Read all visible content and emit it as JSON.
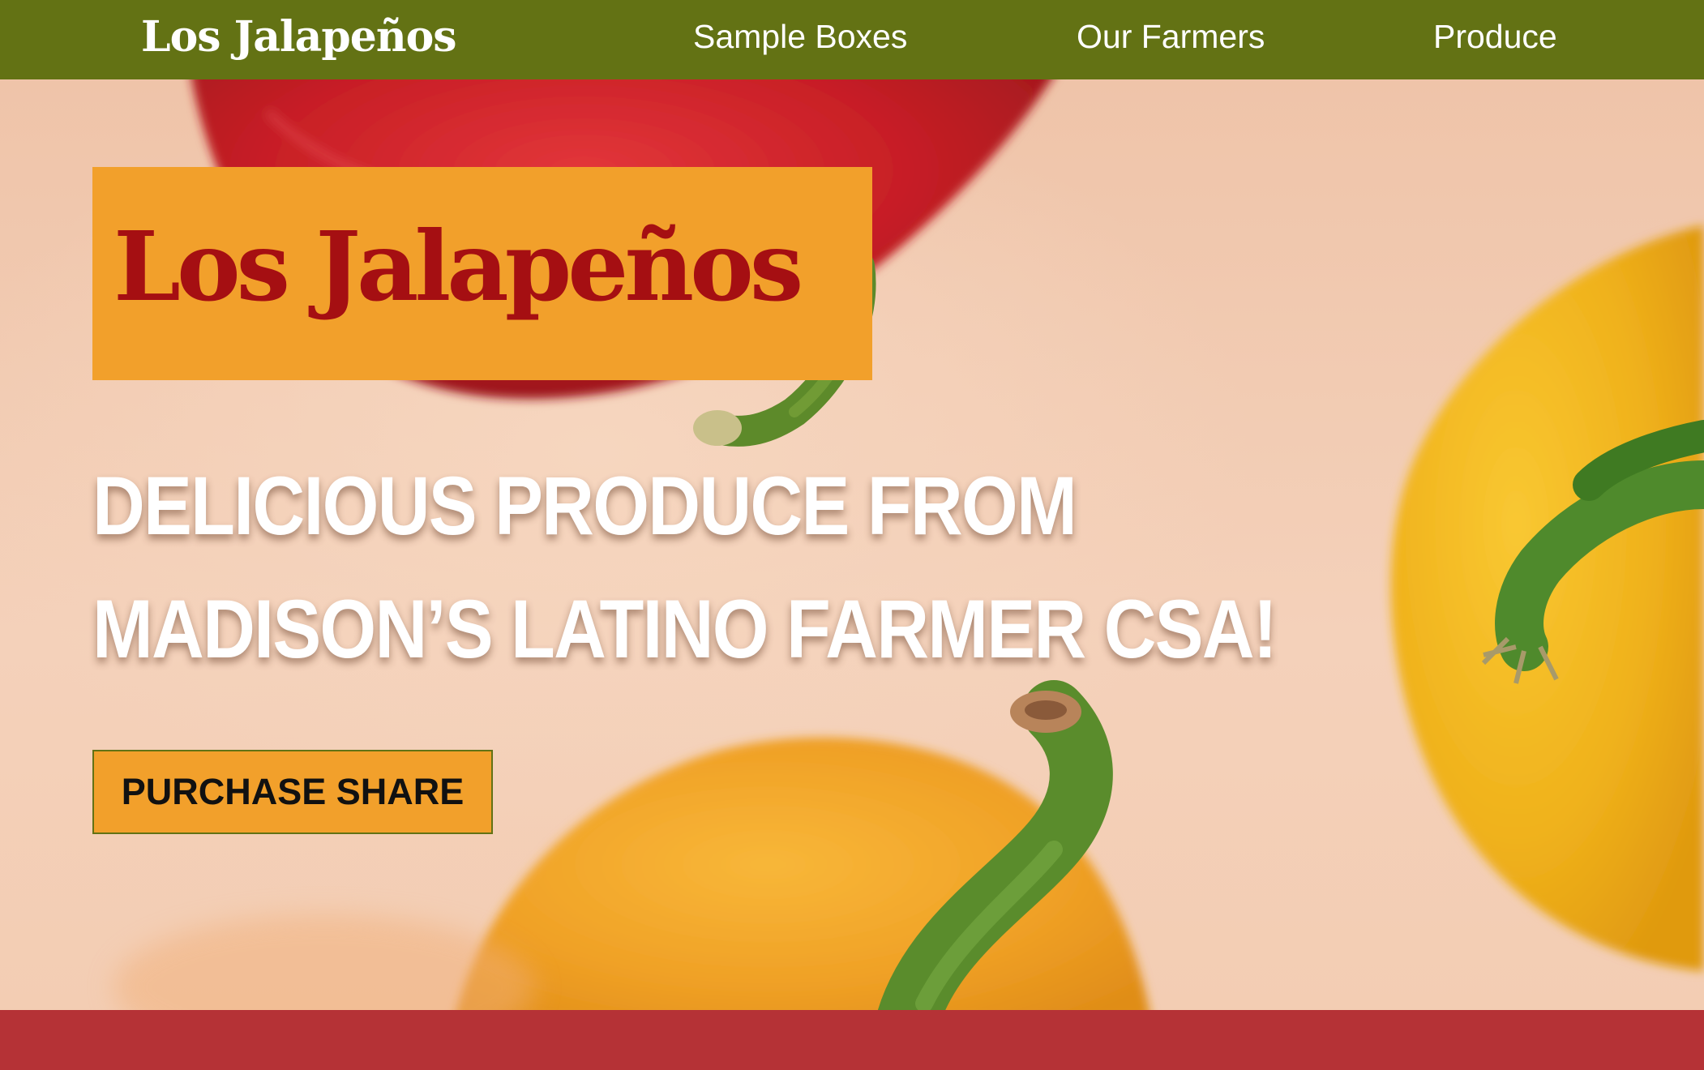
{
  "nav": {
    "brand": "Los Jalapeños",
    "links": [
      {
        "label": "Sample Boxes"
      },
      {
        "label": "Our Farmers"
      },
      {
        "label": "Produce"
      }
    ]
  },
  "hero": {
    "logo_text": "Los Jalapeños",
    "headline": "DELICIOUS PRODUCE FROM MADISON’S LATINO FARMER CSA!",
    "cta_label": "PURCHASE SHARE",
    "image_subject": "red and yellow bell peppers"
  },
  "colors": {
    "nav_background": "#637214",
    "logo_box": "#f2a02b",
    "logo_text": "#a50f12",
    "cta_background": "#f2a02b",
    "footer_band": "#b53236",
    "hero_background": "#f2cfb8"
  }
}
